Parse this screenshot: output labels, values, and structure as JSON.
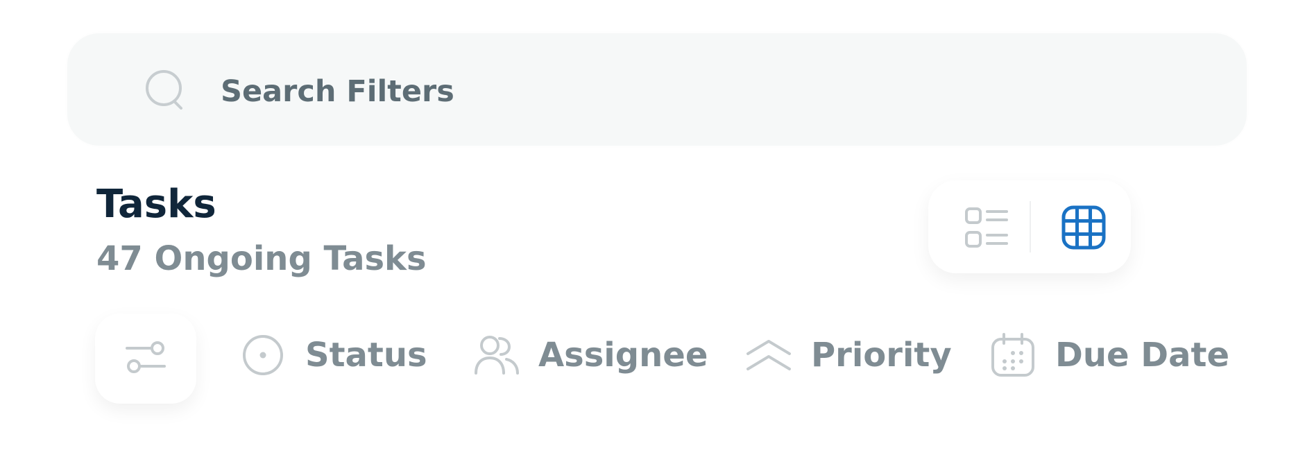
{
  "search": {
    "placeholder": "Search Filters",
    "icon": "search-icon"
  },
  "header": {
    "title": "Tasks",
    "subtitle": "47 Ongoing Tasks"
  },
  "view_toggle": {
    "options": [
      {
        "name": "list-view",
        "icon": "list-view-icon",
        "active": false
      },
      {
        "name": "grid-view",
        "icon": "grid-view-icon",
        "active": true
      }
    ]
  },
  "filters": {
    "toggle_icon": "sliders-icon",
    "chips": [
      {
        "label": "Status",
        "icon": "status-icon"
      },
      {
        "label": "Assignee",
        "icon": "users-icon"
      },
      {
        "label": "Priority",
        "icon": "priority-icon"
      },
      {
        "label": "Due Date",
        "icon": "calendar-icon"
      }
    ]
  },
  "colors": {
    "accent": "#1a72c4",
    "title": "#10263a",
    "muted_text": "#7f8c93",
    "icon_gray": "#c4cacd",
    "search_bg": "#f6f8f8"
  }
}
